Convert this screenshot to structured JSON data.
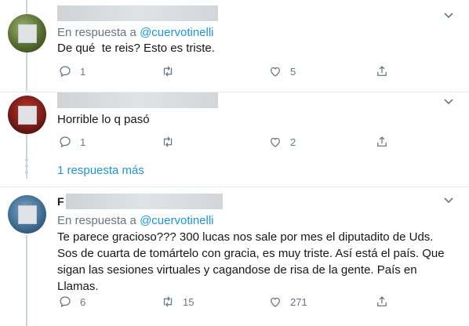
{
  "tweets": [
    {
      "reply_prefix": "En respuesta a",
      "reply_handle": "@cuervotinelli",
      "text": "De qué  te reis? Esto es triste.",
      "reply_count": "1",
      "retweet_count": "",
      "like_count": "5"
    },
    {
      "text": "Horrible lo q pasó",
      "reply_count": "1",
      "retweet_count": "",
      "like_count": "2"
    },
    {
      "name_initial": "F",
      "reply_prefix": "En respuesta a",
      "reply_handle": "@cuervotinelli",
      "text": "Te parece gracioso??? 300 lucas nos sale por mes el diputadito de Uds.\nSos de cuarta de tomártelo con gracia, es muy triste. Así está el país. Que\nsigan las sesiones virtuales y cagandose de risa de la gente. País en\nLlamas.",
      "reply_count": "6",
      "retweet_count": "15",
      "like_count": "271"
    }
  ],
  "more_replies": "1 respuesta más",
  "icons": {
    "reply": "reply-icon",
    "retweet": "retweet-icon",
    "like": "like-icon",
    "share": "share-icon",
    "caret": "chevron-down-icon"
  },
  "colors": {
    "link": "#1b95e0",
    "secondary": "#657786",
    "thread_line": "#ccd6dd"
  }
}
